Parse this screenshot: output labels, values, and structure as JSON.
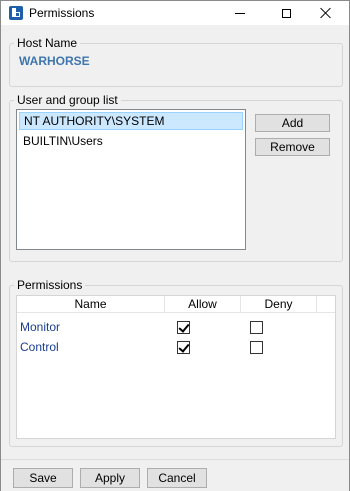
{
  "window": {
    "title": "Permissions"
  },
  "host": {
    "label": "Host Name",
    "value": "WARHORSE"
  },
  "users": {
    "label": "User and group list",
    "items": [
      {
        "name": "NT AUTHORITY\\SYSTEM",
        "selected": true
      },
      {
        "name": "BUILTIN\\Users",
        "selected": false
      }
    ],
    "add_label": "Add",
    "remove_label": "Remove"
  },
  "permissions": {
    "label": "Permissions",
    "columns": {
      "name": "Name",
      "allow": "Allow",
      "deny": "Deny"
    },
    "rows": [
      {
        "name": "Monitor",
        "allow": true,
        "deny": false
      },
      {
        "name": "Control",
        "allow": true,
        "deny": false
      }
    ]
  },
  "footer": {
    "save_label": "Save",
    "apply_label": "Apply",
    "cancel_label": "Cancel"
  },
  "colors": {
    "host_value": "#3f76ad",
    "selection_bg": "#cce8ff",
    "perm_name": "#1a3e8c"
  },
  "icons": {
    "app": "app-logo-icon",
    "minimize": "minimize-icon",
    "maximize": "maximize-icon",
    "close": "close-icon"
  }
}
